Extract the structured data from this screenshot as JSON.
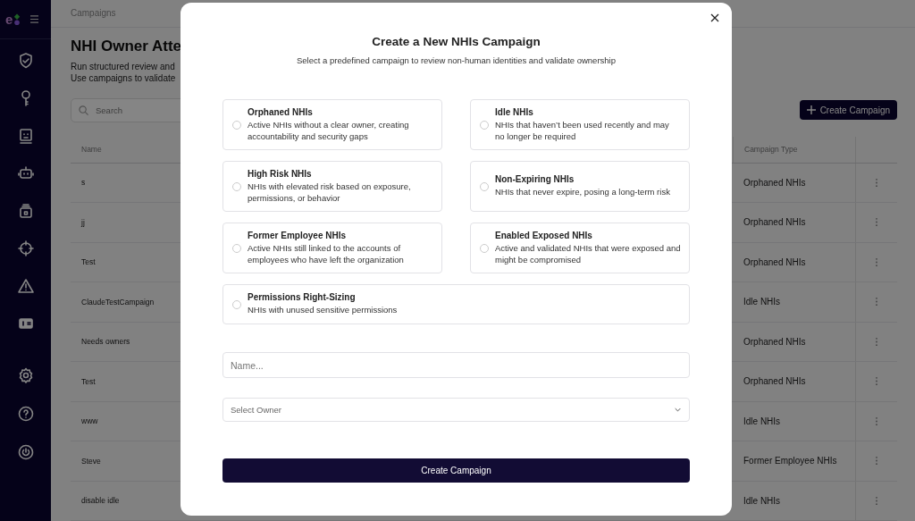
{
  "sidebar": {
    "logo_text": "e"
  },
  "page": {
    "breadcrumb": "Campaigns",
    "title": "NHI Owner Atte",
    "description": [
      "Run structured review and",
      "Use campaigns to validate"
    ],
    "search": {
      "placeholder": "Search"
    },
    "create_button": "Create Campaign",
    "table": {
      "columns": [
        "Name",
        "Campaign Type"
      ],
      "rows": [
        {
          "name": "s",
          "campaign_type": "Orphaned NHIs"
        },
        {
          "name": "jj",
          "campaign_type": "Orphaned NHIs"
        },
        {
          "name": "Test",
          "campaign_type": "Orphaned NHIs"
        },
        {
          "name": "ClaudeTestCampaign",
          "campaign_type": "Idle NHIs"
        },
        {
          "name": "Needs owners",
          "campaign_type": "Orphaned NHIs"
        },
        {
          "name": "Test",
          "campaign_type": "Orphaned NHIs"
        },
        {
          "name": "www",
          "campaign_type": "Idle NHIs"
        },
        {
          "name": "Steve",
          "campaign_type": "Former Employee NHIs"
        },
        {
          "name": "disable idle",
          "campaign_type": "Idle NHIs"
        }
      ]
    }
  },
  "modal": {
    "title": "Create a New NHIs Campaign",
    "subtitle": "Select a predefined campaign to review non-human identities and validate ownership",
    "options": [
      {
        "title": "Orphaned NHIs",
        "description": "Active NHIs without a clear owner, creating accountability and security gaps",
        "selected": false,
        "wide": false
      },
      {
        "title": "Idle NHIs",
        "description": "NHIs that haven’t been used recently and may no longer be required",
        "selected": false,
        "wide": false
      },
      {
        "title": "High Risk NHIs",
        "description": "NHIs with elevated risk based on exposure, permissions, or behavior",
        "selected": false,
        "wide": false
      },
      {
        "title": "Non-Expiring NHIs",
        "description": "NHIs that never expire, posing a long-term risk",
        "selected": false,
        "wide": false
      },
      {
        "title": "Former Employee NHIs",
        "description": "Active NHIs still linked to the accounts of employees who have left the organization",
        "selected": false,
        "wide": false
      },
      {
        "title": "Enabled Exposed NHIs",
        "description": "Active and validated NHIs that were exposed and might be compromised",
        "selected": false,
        "wide": false
      },
      {
        "title": "Permissions Right-Sizing",
        "description": "NHIs with unused sensitive permissions",
        "selected": false,
        "wide": true
      }
    ],
    "name_field": {
      "placeholder": "Name..."
    },
    "owner_select": {
      "placeholder": "Select Owner"
    },
    "submit_button": "Create Campaign"
  }
}
